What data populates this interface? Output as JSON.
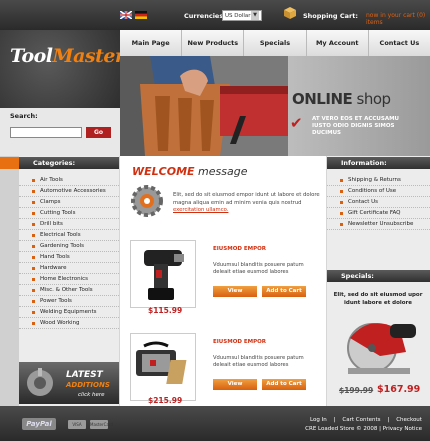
{
  "header": {
    "flags": [
      "uk-flag",
      "german-flag"
    ],
    "currencies_label": "Currencies:",
    "currency_selected": "US Dollar",
    "cart_label": "Shopping Cart:",
    "cart_value": "now in your cart (0) items"
  },
  "logo": {
    "part1": "Tool",
    "part2": "Master"
  },
  "nav": [
    "Main Page",
    "New Products",
    "Specials",
    "My Account",
    "Contact Us"
  ],
  "hero": {
    "title_bold": "ONLINE",
    "title_light": " shop",
    "subtitle": "AT VERO EOS ET ACCUSAMU IUSTO ODIO DIGNIS SIMOS DUCIMUS"
  },
  "search": {
    "label": "Search:",
    "button": "Go"
  },
  "categories": {
    "header": "Categories:",
    "items": [
      "Air Tools",
      "Automotive Accessories",
      "Clamps",
      "Cutting Tools",
      "Drill bits",
      "Electrical Tools",
      "Gardening Tools",
      "Hand Tools",
      "Hardware",
      "Home Electronics",
      "Misc. & Other Tools",
      "Power Tools",
      "Welding Equipments",
      "Wood Working"
    ]
  },
  "latest": {
    "line1": "LATEST",
    "line2": "ADDITIONS",
    "line3": "click here"
  },
  "welcome": {
    "title_em": "WELCOME",
    "title_rest": " message",
    "text": "Elit, sed do sit eiusmod empor idunt ut labore et dolore magna aliqua emin ad minim venia quis nostrud",
    "link": "exercitation ullamco."
  },
  "products": [
    {
      "title": "EIUSMOD EMPOR",
      "desc": "Vduumsul blanditis posuere patum deleait etiae eusmod labores",
      "view": "View",
      "add": "Add to Cart",
      "price": "$115.99"
    },
    {
      "title": "EIUSMOD EMPOR",
      "desc": "Vduumsul blanditis posuere patum deleait etiae eusmod labores",
      "view": "View",
      "add": "Add to Cart",
      "price": "$215.99"
    }
  ],
  "information": {
    "header": "Information:",
    "items": [
      "Shipping & Returns",
      "Conditions of Use",
      "Contact Us",
      "Gift Certificate FAQ",
      "Newsletter Unsubscribe"
    ]
  },
  "specials": {
    "header": "Specials:",
    "name": "Elit, sed do sit eiusmod upor idunt labore et dolore",
    "old_price": "$199.99",
    "new_price": "$167.99"
  },
  "footer": {
    "paypal": "PayPal",
    "cards": [
      "VISA",
      "MasterCard"
    ],
    "links": [
      "Log In",
      "Cart Contents",
      "Checkout"
    ],
    "copyright": "CRE Loaded Store © 2008 | Privacy Notice"
  },
  "colors": {
    "accent": "#e87010",
    "brand_red": "#c02020",
    "dark": "#2a2a2a"
  }
}
